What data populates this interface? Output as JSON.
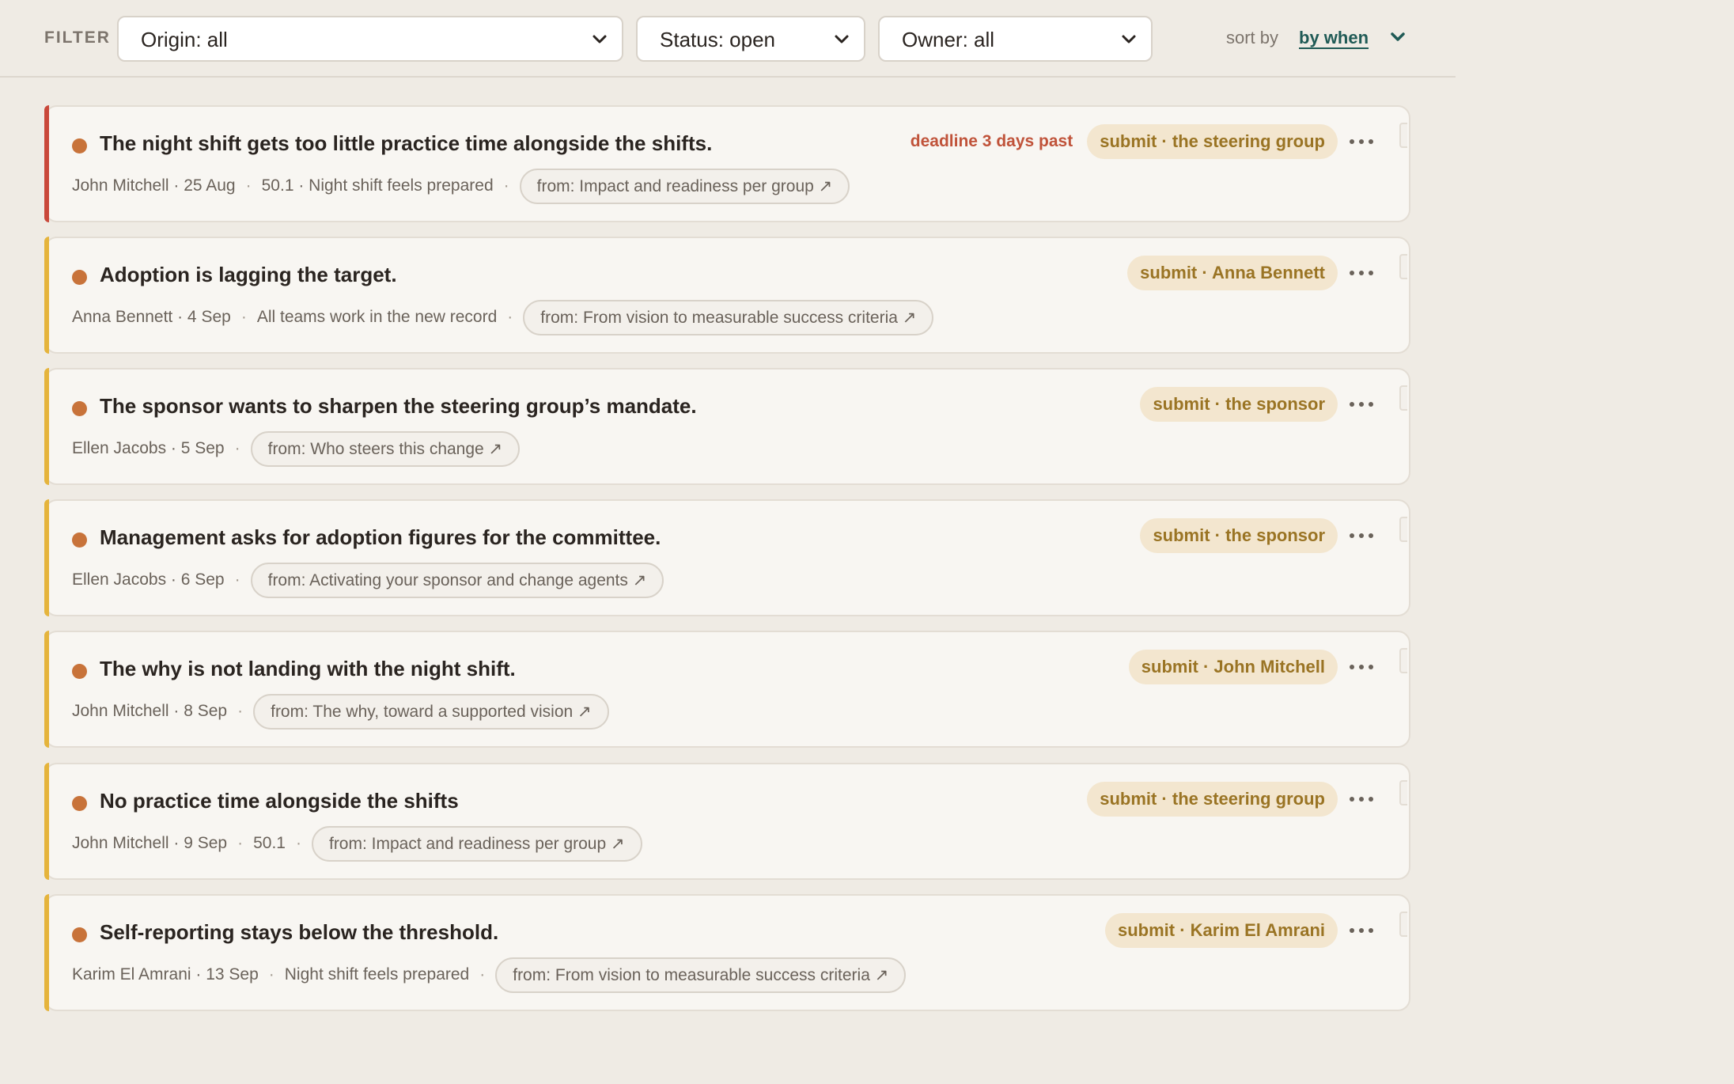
{
  "filter": {
    "label": "FILTER",
    "origin": "Origin: all",
    "status": "Status: open",
    "owner": "Owner: all",
    "sort_label": "sort by",
    "sort_value": "by when"
  },
  "colors": {
    "overdue_accent": "#c9483a",
    "open_accent": "#e5b43c",
    "status_dot": "#c8733a",
    "action_pill_bg": "#f3e6cf",
    "action_pill_text": "#9a7424",
    "deadline_text": "#c0533a",
    "sort_link": "#1f5a55"
  },
  "items": [
    {
      "title": "The night shift gets too little practice time alongside the shifts.",
      "owner_date": "John Mitchell · 25 Aug",
      "detail": "50.1 · Night shift feels prepared",
      "origin": "from: Impact and readiness per group ↗",
      "deadline": "deadline 3 days past",
      "action": "submit · the steering group"
    },
    {
      "title": "Adoption is lagging the target.",
      "owner_date": "Anna Bennett · 4 Sep",
      "detail": "All teams work in the new record",
      "origin": "from: From vision to measurable success criteria ↗",
      "deadline": "",
      "action": "submit · Anna Bennett"
    },
    {
      "title": "The sponsor wants to sharpen the steering group’s mandate.",
      "owner_date": "Ellen Jacobs · 5 Sep",
      "detail": "",
      "origin": "from: Who steers this change ↗",
      "deadline": "",
      "action": "submit · the sponsor"
    },
    {
      "title": "Management asks for adoption figures for the committee.",
      "owner_date": "Ellen Jacobs · 6 Sep",
      "detail": "",
      "origin": "from: Activating your sponsor and change agents ↗",
      "deadline": "",
      "action": "submit · the sponsor"
    },
    {
      "title": "The why is not landing with the night shift.",
      "owner_date": "John Mitchell · 8 Sep",
      "detail": "",
      "origin": "from: The why, toward a supported vision ↗",
      "deadline": "",
      "action": "submit · John Mitchell"
    },
    {
      "title": "No practice time alongside the shifts",
      "owner_date": "John Mitchell · 9 Sep",
      "detail": "50.1",
      "origin": "from: Impact and readiness per group ↗",
      "deadline": "",
      "action": "submit · the steering group"
    },
    {
      "title": "Self-reporting stays below the threshold.",
      "owner_date": "Karim El Amrani · 13 Sep",
      "detail": "Night shift feels prepared",
      "origin": "from: From vision to measurable success criteria ↗",
      "deadline": "",
      "action": "submit · Karim El Amrani"
    }
  ]
}
